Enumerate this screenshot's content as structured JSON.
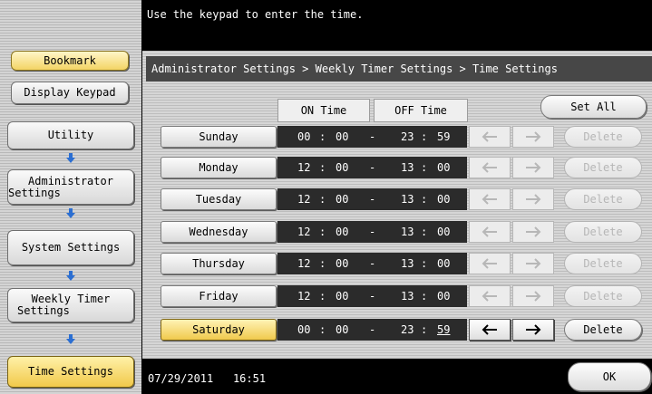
{
  "message": "Use the keypad to enter the time.",
  "left_nav": {
    "bookmark": "Bookmark",
    "display_keypad": "Display Keypad",
    "utility": "Utility",
    "administrator_settings_line1": "Administrator",
    "administrator_settings_line2": "Settings",
    "system_settings": "System Settings",
    "weekly_timer_line1": "Weekly Timer",
    "weekly_timer_line2": "Settings",
    "time_settings": "Time Settings"
  },
  "breadcrumb": "Administrator Settings > Weekly Timer Settings > Time Settings",
  "columns": {
    "on": "ON Time",
    "off": "OFF Time"
  },
  "set_all": "Set All",
  "days": [
    {
      "label": "Sunday",
      "on_h": "00",
      "on_m": "00",
      "dash": "-",
      "off_h": "23",
      "off_m": "59"
    },
    {
      "label": "Monday",
      "on_h": "12",
      "on_m": "00",
      "dash": "-",
      "off_h": "13",
      "off_m": "00"
    },
    {
      "label": "Tuesday",
      "on_h": "12",
      "on_m": "00",
      "dash": "-",
      "off_h": "13",
      "off_m": "00"
    },
    {
      "label": "Wednesday",
      "on_h": "12",
      "on_m": "00",
      "dash": "-",
      "off_h": "13",
      "off_m": "00"
    },
    {
      "label": "Thursday",
      "on_h": "12",
      "on_m": "00",
      "dash": "-",
      "off_h": "13",
      "off_m": "00"
    },
    {
      "label": "Friday",
      "on_h": "12",
      "on_m": "00",
      "dash": "-",
      "off_h": "13",
      "off_m": "00"
    },
    {
      "label": "Saturday",
      "on_h": "00",
      "on_m": "00",
      "dash": "-",
      "off_h": "23",
      "off_m": "59"
    }
  ],
  "selected_day": "Saturday",
  "time_colon": ":",
  "arrows": {
    "left": "←",
    "right": "→"
  },
  "delete": "Delete",
  "footer": {
    "date": "07/29/2011",
    "time": "16:51"
  },
  "ok": "OK",
  "colors": {
    "selected_yellow": "#f3d465",
    "time_box": "#2b2b2b",
    "breadcrumb_bar": "#474747",
    "arrow_blue": "#2c6fd2"
  },
  "icons": {
    "down_arrow": "arrow-down-icon",
    "left_arrow": "arrow-left-icon",
    "right_arrow": "arrow-right-icon"
  }
}
